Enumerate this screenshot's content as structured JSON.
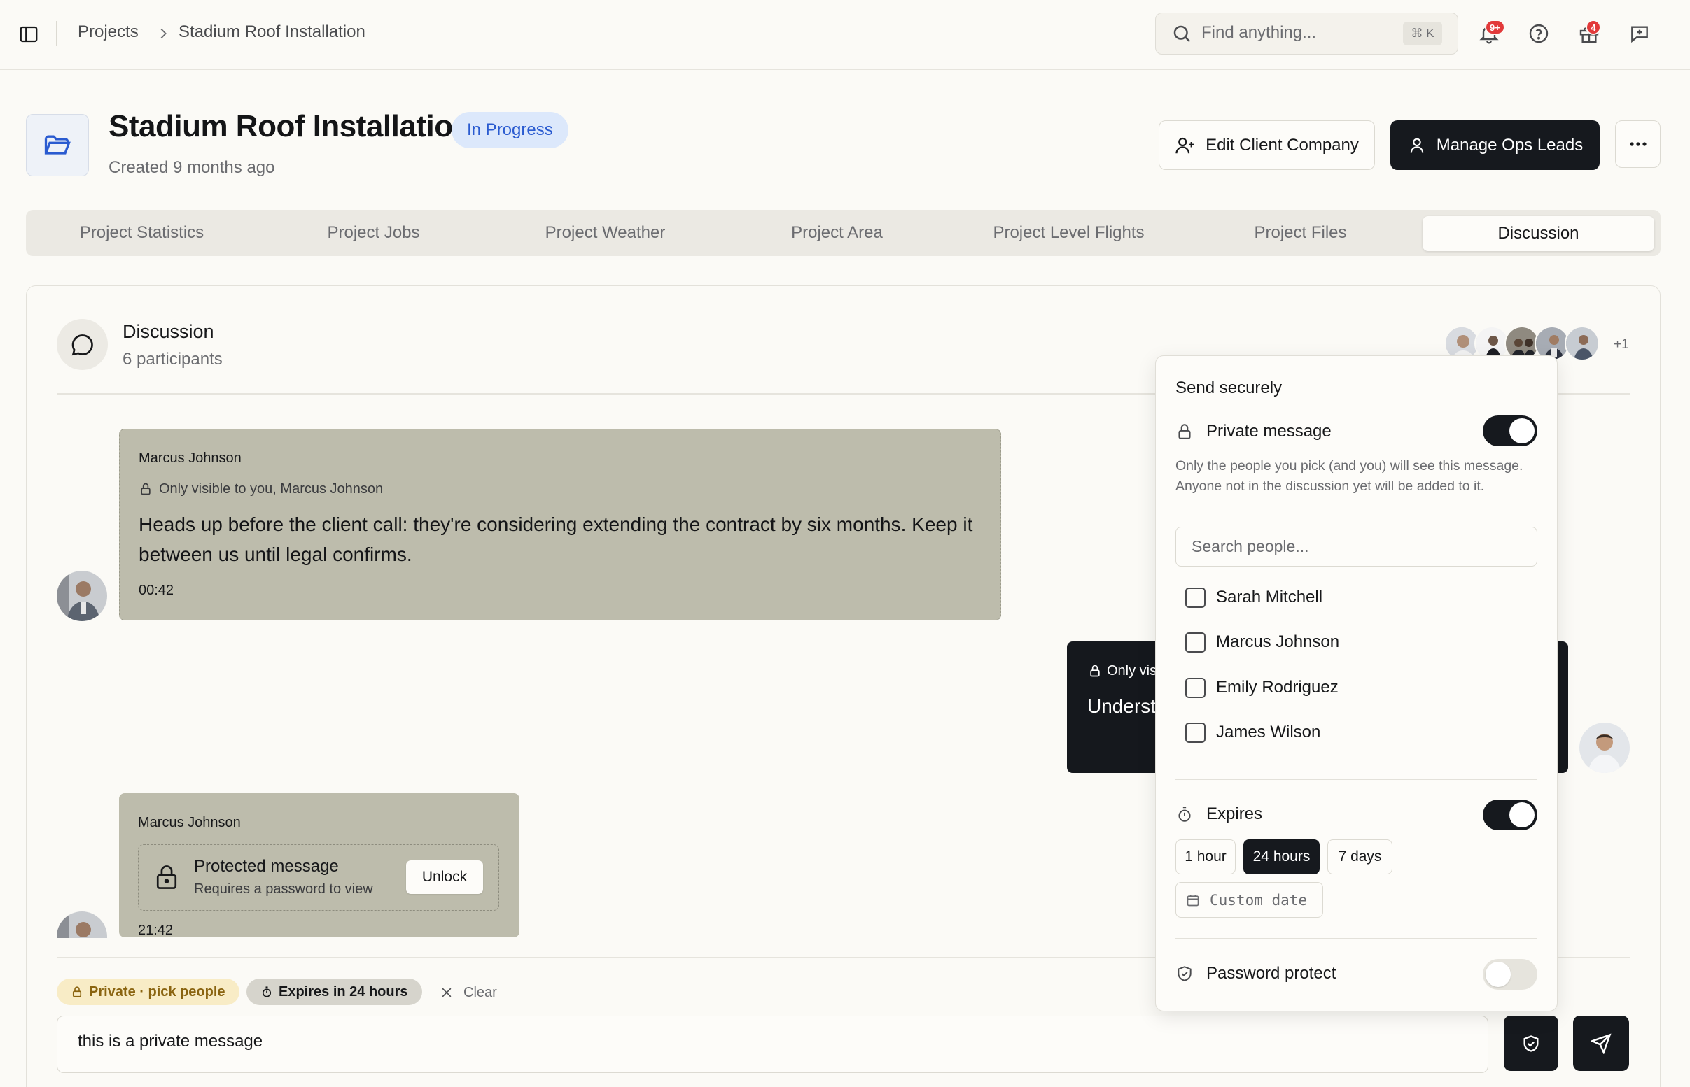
{
  "breadcrumb": {
    "root": "Projects",
    "current": "Stadium Roof Installation"
  },
  "search": {
    "placeholder": "Find anything...",
    "shortcut": "⌘ K"
  },
  "topbar": {
    "notifications_badge": "9+",
    "gifts_badge": "4"
  },
  "project": {
    "title": "Stadium Roof Installation",
    "status": "In Progress",
    "created": "Created 9 months ago",
    "edit_client_label": "Edit Client Company",
    "manage_leads_label": "Manage Ops Leads"
  },
  "tabs": [
    {
      "label": "Project Statistics",
      "active": false
    },
    {
      "label": "Project Jobs",
      "active": false
    },
    {
      "label": "Project Weather",
      "active": false
    },
    {
      "label": "Project Area",
      "active": false
    },
    {
      "label": "Project Level Flights",
      "active": false
    },
    {
      "label": "Project Files",
      "active": false
    },
    {
      "label": "Discussion",
      "active": true
    }
  ],
  "discussion": {
    "title": "Discussion",
    "participants": "6 participants",
    "more_participants": "+1"
  },
  "messages": [
    {
      "author": "Marcus Johnson",
      "visibility": "Only visible to you, Marcus Johnson",
      "body": "Heads up before the client call: they're considering extending the contract by six months. Keep it between us until legal confirms.",
      "time": "00:42"
    },
    {
      "visibility": "Only vis",
      "body": "Underst"
    },
    {
      "author": "Marcus Johnson",
      "protected_title": "Protected message",
      "protected_sub": "Requires a password to view",
      "unlock_label": "Unlock",
      "time": "21:42"
    }
  ],
  "composer": {
    "chip_private": "Private · pick people",
    "chip_expires": "Expires in 24 hours",
    "clear_label": "Clear",
    "text": "this is a private message"
  },
  "popover": {
    "title": "Send securely",
    "private_label": "Private message",
    "private_on": true,
    "help": "Only the people you pick (and you) will see this message. Anyone not in the discussion yet will be added to it.",
    "people_placeholder": "Search people...",
    "people": [
      "Sarah Mitchell",
      "Marcus Johnson",
      "Emily Rodriguez",
      "James Wilson"
    ],
    "expires_label": "Expires",
    "expires_on": true,
    "expire_options": [
      "1 hour",
      "24 hours",
      "7 days"
    ],
    "expire_selected": "24 hours",
    "custom_date": "Custom date",
    "password_label": "Password protect",
    "password_on": false
  },
  "colors": {
    "accent_dark": "#16191e",
    "status_blue_bg": "#dce8fb",
    "status_blue_text": "#2a5bd0",
    "private_chip_bg": "#f8ecc6",
    "badge_red": "#e23a3a"
  }
}
